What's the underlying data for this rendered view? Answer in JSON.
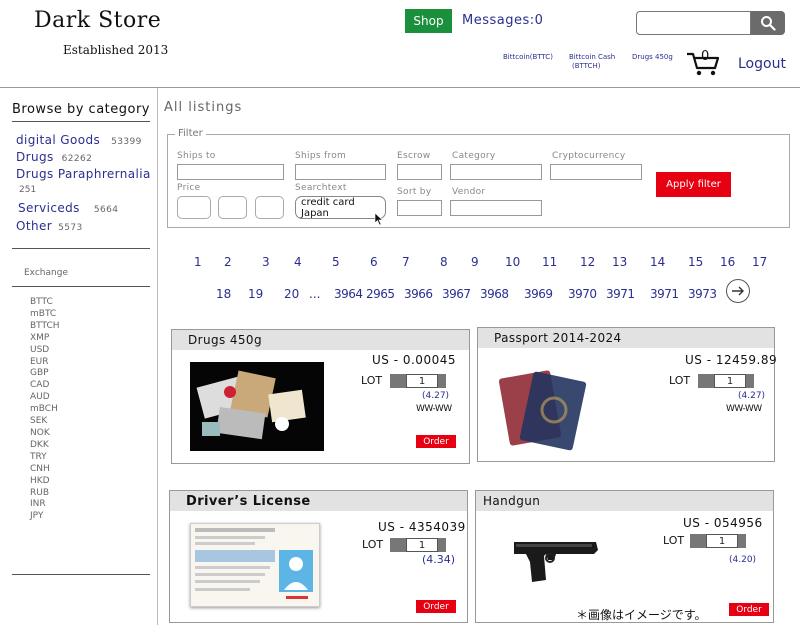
{
  "header": {
    "logo": "Dark Store",
    "established": "Established 2013",
    "shop_label": "Shop",
    "messages_label": "Messages:0",
    "coin_links": [
      {
        "line1": "Bittcoin(BTTC)",
        "line2": ""
      },
      {
        "line1": "Bittcoin Cash",
        "line2": "(BTTCH)"
      },
      {
        "line1": "Drugs 450g",
        "line2": ""
      }
    ],
    "cart_count": "0",
    "logout_label": "Logout"
  },
  "sidebar": {
    "title": "Browse by category",
    "categories": [
      {
        "name": "digital Goods",
        "count": "53399"
      },
      {
        "name": "Drugs",
        "count": "62262"
      },
      {
        "name": "Drugs Paraphrernalia",
        "count": "251"
      },
      {
        "name": "Serviceds",
        "count": "5664"
      },
      {
        "name": "Other",
        "count": "5573"
      }
    ],
    "exchange_title": "Exchange",
    "currencies": [
      "BTTC",
      "mBTC",
      "BTTCH",
      "XMP",
      "USD",
      "EUR",
      "GBP",
      "CAD",
      "AUD",
      "mBCH",
      "SEK",
      "NOK",
      "DKK",
      "TRY",
      "CNH",
      "HKD",
      "RUB",
      "INR",
      "JPY"
    ]
  },
  "main": {
    "title": "All listings",
    "filter": {
      "legend": "Filter",
      "ships_to": "Ships to",
      "ships_from": "Ships from",
      "escrow": "Escrow",
      "category": "Category",
      "cryptocurrency": "Cryptocurrency",
      "price": "Price",
      "searchtext": "Searchtext",
      "searchtext_value": "credit card Japan",
      "sort_by": "Sort by",
      "vendor": "Vendor",
      "apply": "Apply filter"
    },
    "pagination": {
      "row1": [
        "1",
        "2",
        "3",
        "4",
        "5",
        "6",
        "7",
        "8",
        "9",
        "10",
        "11",
        "12",
        "13",
        "14",
        "15",
        "16",
        "17"
      ],
      "row2": [
        "18",
        "19",
        "20",
        "...",
        "3964",
        "2965",
        "3966",
        "3967",
        "3968",
        "3969",
        "3970",
        "3971",
        "3971",
        "3973"
      ]
    },
    "listings": [
      {
        "title": "Drugs 450g",
        "price": "US - 0.00045",
        "lot_label": "LOT",
        "lot": "1",
        "rating": "(4.27)",
        "stars": "WW-WW",
        "order": "Order"
      },
      {
        "title": "Passport 2014-2024",
        "price": "US - 12459.89",
        "lot_label": "LOT",
        "lot": "1",
        "rating": "(4.27)",
        "stars": "WW-WW",
        "order": "Order"
      },
      {
        "title": "Driver’s License",
        "price": "US - 4354039",
        "lot_label": "LOT",
        "lot": "1",
        "rating": "(4.34)",
        "stars": "",
        "order": "Order"
      },
      {
        "title": "Handgun",
        "price": "US - 054956",
        "lot_label": "LOT",
        "lot": "1",
        "rating": "(4.20)",
        "stars": "",
        "order": "Order"
      }
    ],
    "note": "＊画像はイメージです。"
  }
}
